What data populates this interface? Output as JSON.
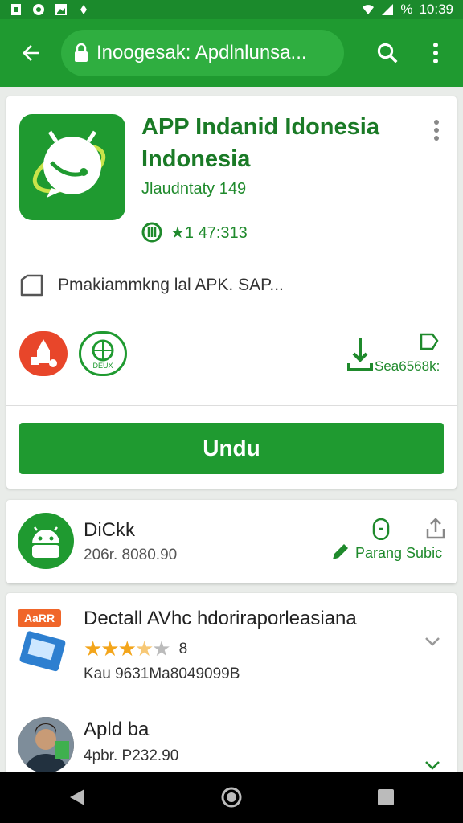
{
  "status_bar": {
    "time": "10:39",
    "battery_text": "%"
  },
  "url_bar": {
    "url_text": "Inoogesak: Apdlnlunsa..."
  },
  "app": {
    "title": "APP Indanid Idonesia Indonesia",
    "subtitle": "Jlaudntaty 149",
    "rating_text": "★1 47:313",
    "permission_text": "Pmakiammkng lal APK. SAP...",
    "size_text": "Sea6568k:",
    "install_label": "Undu",
    "badge_green_text": "DEUX"
  },
  "developer": {
    "name": "DiCkk",
    "sub": "206r. 8080.90",
    "action_label": "Parang Subic"
  },
  "list": [
    {
      "badge": "AaRR",
      "title": "Dectall AVhc hdoriraporleasiana",
      "rating_value": "8",
      "rating_stars": 3.5,
      "line3": "Kau 9631Ma8049099B"
    },
    {
      "title": "Apld ba",
      "sub": "4pbr. P232.90"
    }
  ],
  "colors": {
    "primary": "#1f9a30",
    "dark": "#1b8a2c",
    "star": "#f3a51b"
  }
}
